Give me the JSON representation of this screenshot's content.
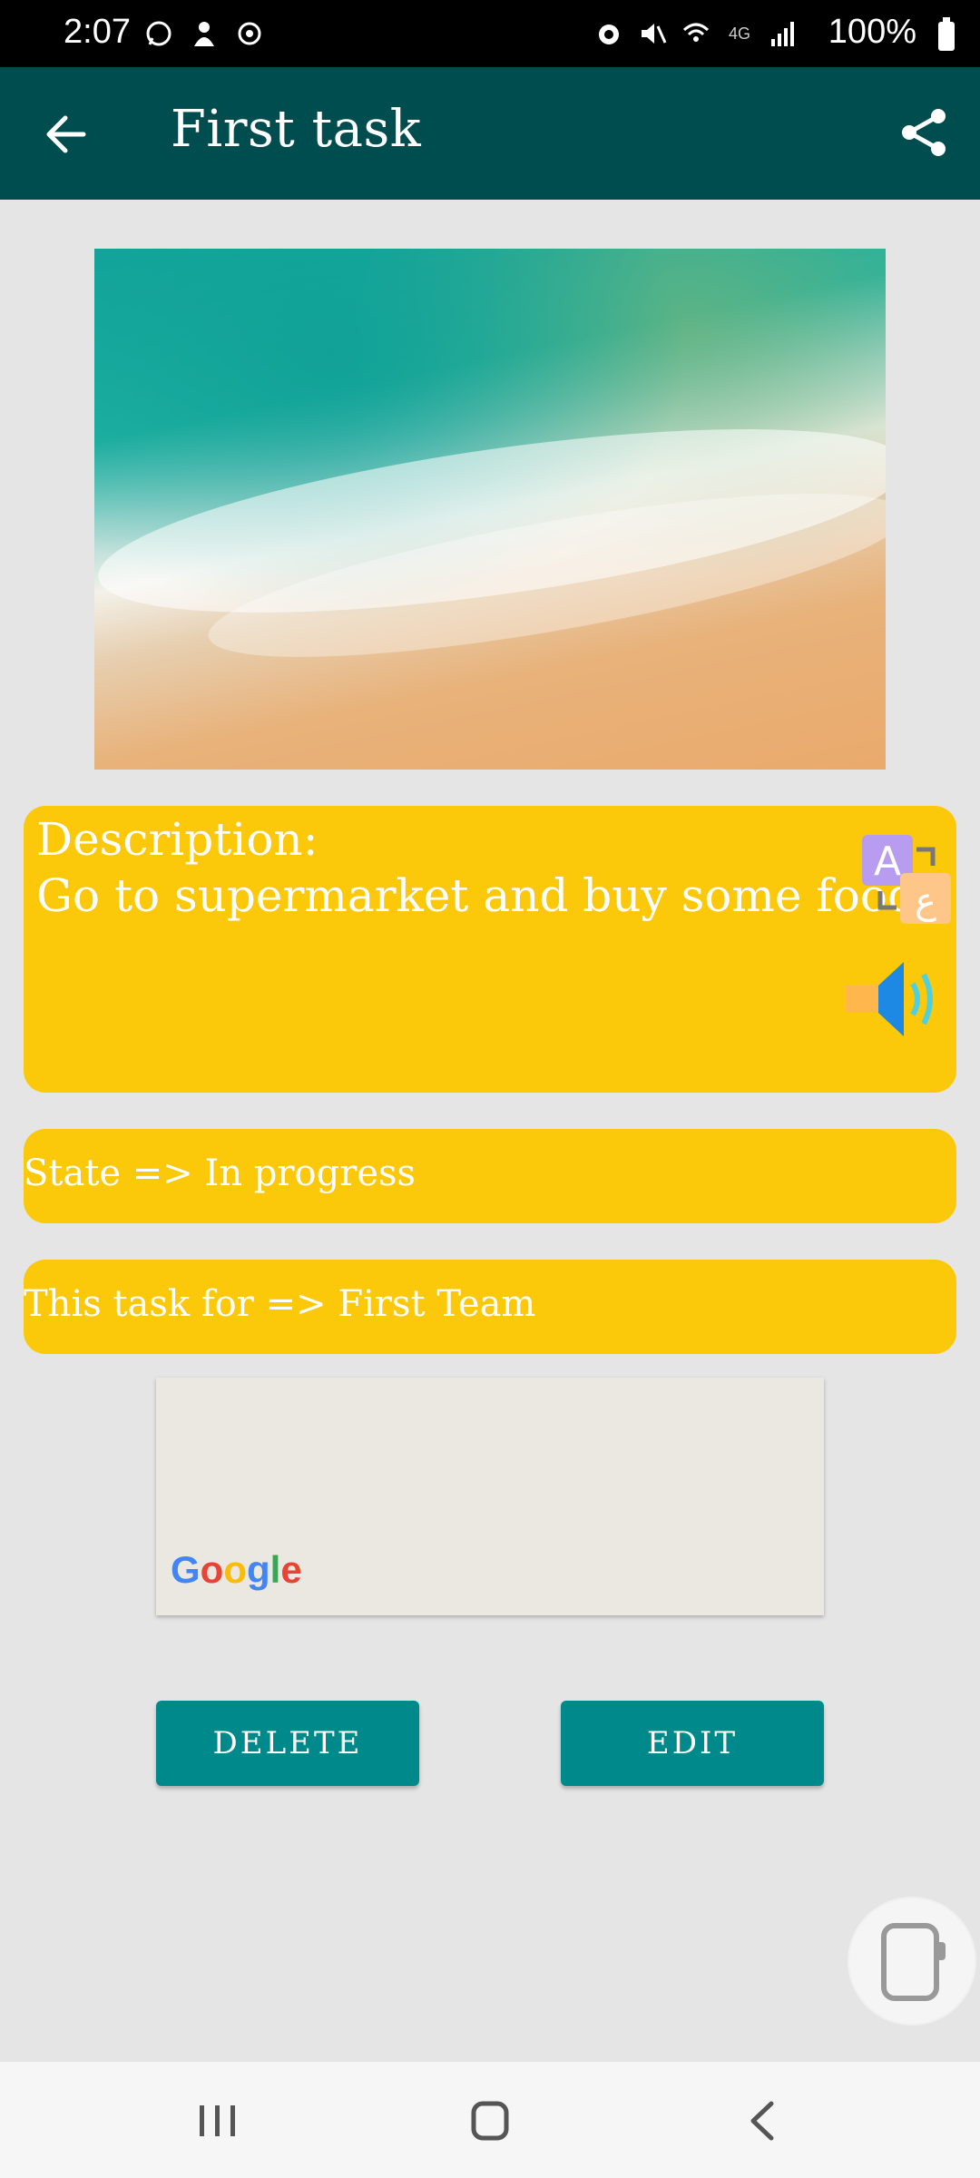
{
  "status_bar": {
    "time": "2:07",
    "battery": "100%",
    "network": "4G",
    "icons_left": [
      "whatsapp-icon",
      "notification-icon",
      "sync-icon"
    ],
    "icons_right": [
      "alarm-icon",
      "mute-icon",
      "wifi-icon",
      "signal-icon",
      "battery-icon"
    ]
  },
  "appbar": {
    "title": "First task"
  },
  "task": {
    "description_label": "Description:",
    "description_text": "Go to supermarket and buy some food",
    "state_line": "State => In progress",
    "team_line": "This task for => First Team"
  },
  "map": {
    "logo_text": "Google"
  },
  "buttons": {
    "delete": "DELETE",
    "edit": "EDIT"
  },
  "colors": {
    "appbar": "#004d4f",
    "card": "#fbc80a",
    "button": "#00898a"
  }
}
